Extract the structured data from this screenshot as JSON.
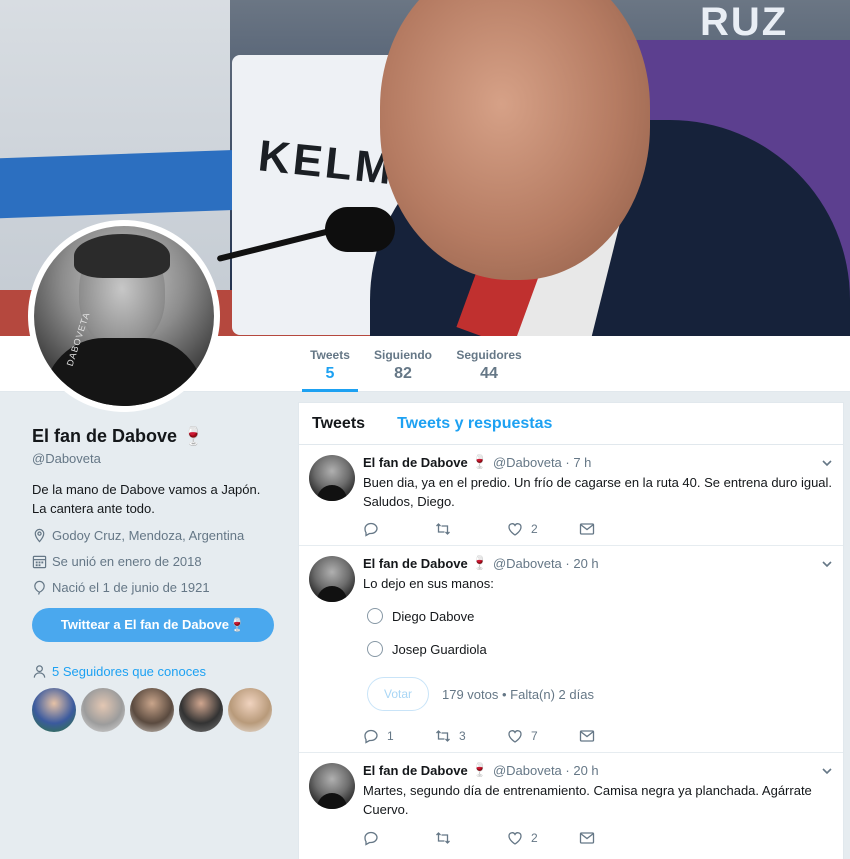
{
  "banner": {
    "sign_text": "KELME",
    "corner_text": "RUZ"
  },
  "avatar": {
    "watermark": "DABOVETA"
  },
  "nav": {
    "tweets_label": "Tweets",
    "tweets_count": "5",
    "siguiendo_label": "Siguiendo",
    "siguiendo_count": "82",
    "seguidores_label": "Seguidores",
    "seguidores_count": "44"
  },
  "profile": {
    "name": "El fan de Dabove",
    "name_emoji": "🍷",
    "handle": "@Daboveta",
    "bio": "De la mano de Dabove vamos a Japón. La cantera ante todo.",
    "location": "Godoy Cruz, Mendoza, Argentina",
    "joined": "Se unió en enero de 2018",
    "born": "Nació el 1 de junio de 1921",
    "tweet_to_button": "Twittear a El fan de Dabove🍷",
    "followers_you_know": "5 Seguidores que conoces"
  },
  "timeline": {
    "tabs": [
      "Tweets",
      "Tweets y respuestas"
    ],
    "tweets": [
      {
        "name": "El fan de Dabove",
        "emoji": "🍷",
        "meta": "@Daboveta · 7 h",
        "text": "Buen dia, ya en el predio. Un frío de cagarse en la ruta 40. Se entrena duro igual. Saludos, Diego.",
        "replies": "",
        "retweets": "",
        "likes": "2"
      },
      {
        "name": "El fan de Dabove",
        "emoji": "🍷",
        "meta": "@Daboveta · 20 h",
        "text": "Lo dejo en sus manos:",
        "poll": {
          "options": [
            "Diego Dabove",
            "Josep Guardiola"
          ],
          "vote_label": "Votar",
          "info": "179 votos • Falta(n) 2 días"
        },
        "replies": "1",
        "retweets": "3",
        "likes": "7"
      },
      {
        "name": "El fan de Dabove",
        "emoji": "🍷",
        "meta": "@Daboveta · 20 h",
        "text": "Martes, segundo día de entrenamiento. Camisa negra ya planchada. Agárrate Cuervo.",
        "replies": "",
        "retweets": "",
        "likes": "2"
      }
    ]
  },
  "colors": {
    "accent": "#1da1f2",
    "button": "#4aa8ee",
    "background": "#e6ecf0",
    "muted": "#657786"
  }
}
